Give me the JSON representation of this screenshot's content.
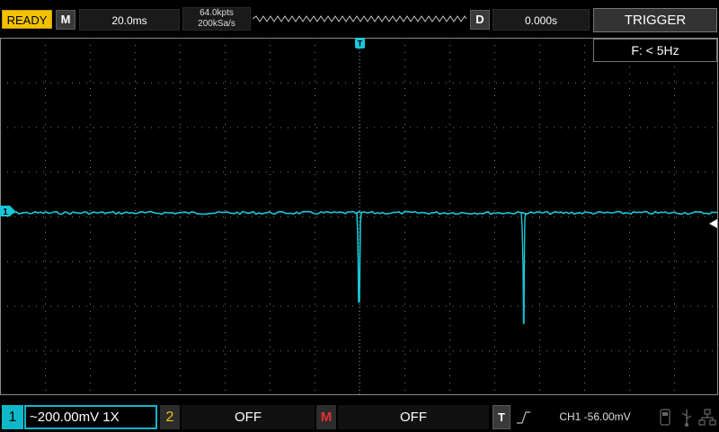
{
  "top": {
    "status": "READY",
    "m_label": "M",
    "timebase": "20.0ms",
    "memory_depth": "64.0kpts",
    "sample_rate": "200kSa/s",
    "d_label": "D",
    "delay": "0.000s",
    "trigger_label": "TRIGGER"
  },
  "freq_readout": "F: < 5Hz",
  "markers": {
    "trigger_marker": "T",
    "ch1_marker": "1"
  },
  "bottom": {
    "ch1": {
      "number": "1",
      "setting": "~200.00mV  1X",
      "color": "#0fb8c9"
    },
    "ch2": {
      "number": "2",
      "state": "OFF",
      "color": "#f2c200"
    },
    "math": {
      "label": "M",
      "state": "OFF",
      "color": "#e53030"
    },
    "trigger": {
      "label": "T",
      "level": "CH1 -56.00mV",
      "edge": "rising-edge-icon"
    }
  },
  "icons": [
    "usb-icon",
    "usb-device-icon",
    "network-icon"
  ],
  "colors": {
    "trace": "#18c8d8",
    "grid": "#6a6a6a",
    "ready": "#f2c200"
  }
}
